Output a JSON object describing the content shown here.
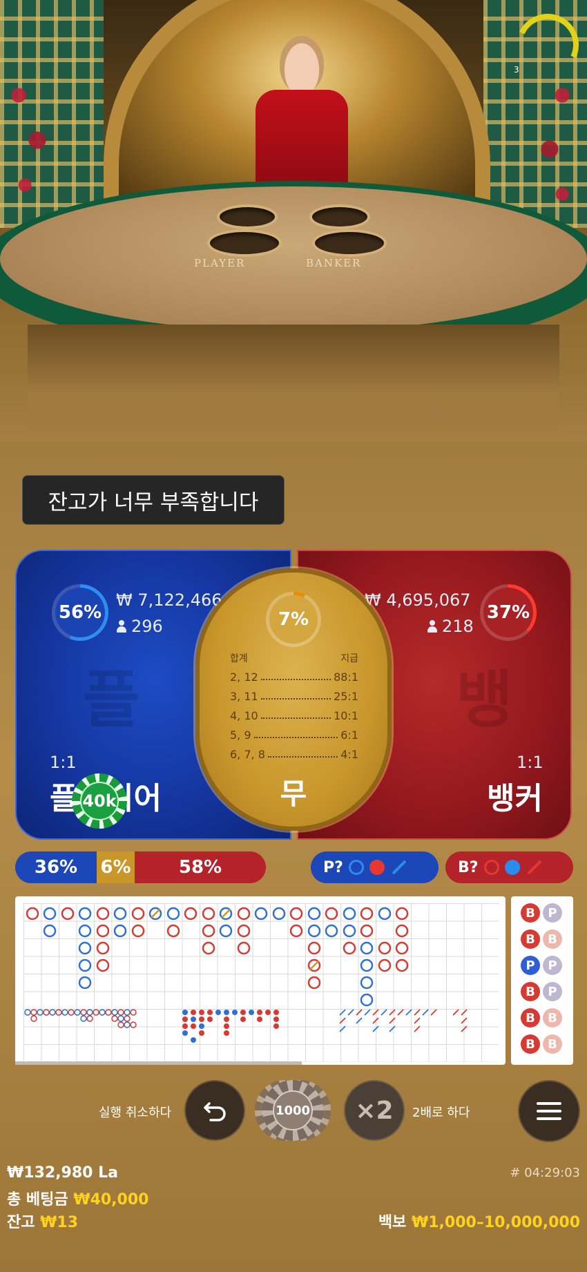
{
  "video": {
    "table_labels": {
      "player": "PLAYER",
      "banker": "BANKER"
    },
    "timer_value": "3",
    "timer_color": "#e3d21a"
  },
  "notification": "잔고가 너무 부족합니다",
  "player": {
    "percent": "56%",
    "amount": "₩ 7,122,466",
    "players": "296",
    "watermark": "플",
    "payout": "1:1",
    "name": "플레이어",
    "color": "#1536a0"
  },
  "banker": {
    "percent": "37%",
    "amount": "₩ 4,695,067",
    "players": "218",
    "watermark": "뱅",
    "payout": "1:1",
    "name": "뱅커",
    "color": "#96191e"
  },
  "tie": {
    "percent": "7%",
    "name": "무",
    "header_total": "합계",
    "header_pay": "지급",
    "rows": [
      {
        "total": "2, 12",
        "pay": "88:1"
      },
      {
        "total": "3, 11",
        "pay": "25:1"
      },
      {
        "total": "4, 10",
        "pay": "10:1"
      },
      {
        "total": "5, 9",
        "pay": "6:1"
      },
      {
        "total": "6, 7, 8",
        "pay": "4:1"
      }
    ]
  },
  "placed_chip": "40k",
  "stats": {
    "player_pct": "36%",
    "tie_pct": "6%",
    "banker_pct": "58%",
    "player_ask": "P?",
    "banker_ask": "B?"
  },
  "side_beads": [
    [
      "B",
      "P"
    ],
    [
      "B",
      "B"
    ],
    [
      "P",
      "P"
    ],
    [
      "B",
      "P"
    ],
    [
      "B",
      "B"
    ],
    [
      "B",
      "B"
    ]
  ],
  "controls": {
    "undo_label": "실행 취소하다",
    "chip_value": "1000",
    "double_symbol": "×2",
    "double_label": "2배로 하다"
  },
  "footer": {
    "balance_line": "₩132,980 La",
    "total_bet_label": "총 베팅금",
    "total_bet_value": "₩40,000",
    "balance_label": "잔고",
    "balance_value": "₩13",
    "round_id": "# 04:29:03",
    "limits_label": "백보",
    "limits_value": "₩1,000–10,000,000"
  }
}
